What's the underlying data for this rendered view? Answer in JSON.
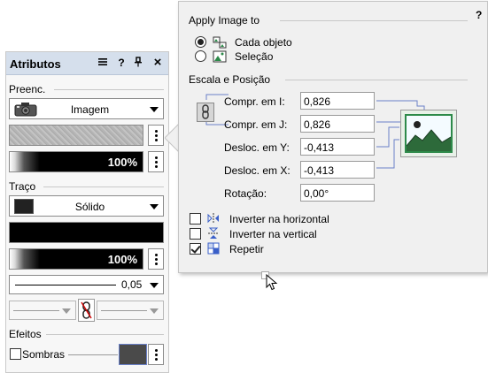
{
  "attributes_panel": {
    "title": "Atributos",
    "header_icons": [
      "menu-icon",
      "help-icon",
      "pin-icon",
      "close-icon"
    ],
    "help_label": "?",
    "close_label": "×",
    "fill": {
      "section_label": "Preenc.",
      "type_value": "Imagem",
      "opacity_value": "100%"
    },
    "stroke": {
      "section_label": "Traço",
      "style_value": "Sólido",
      "opacity_value": "100%",
      "width_value": "0,05"
    },
    "effects": {
      "section_label": "Efeitos",
      "shadows_label": "Sombras",
      "shadows_checked": false
    }
  },
  "popup": {
    "help_label": "?",
    "apply_section": "Apply Image to",
    "apply_options": [
      {
        "label": "Cada objeto",
        "selected": true
      },
      {
        "label": "Seleção",
        "selected": false
      }
    ],
    "scale_section": "Escala e Posição",
    "fields": [
      {
        "label": "Compr. em I:",
        "value": "0,826"
      },
      {
        "label": "Compr. em J:",
        "value": "0,826"
      },
      {
        "label": "Desloc. em Y:",
        "value": "-0,413"
      },
      {
        "label": "Desloc. em X:",
        "value": "-0,413"
      },
      {
        "label": "Rotação:",
        "value": "0,00°"
      }
    ],
    "checkboxes": [
      {
        "label": "Inverter na horizontal",
        "checked": false,
        "icon": "flip-horizontal-icon"
      },
      {
        "label": "Inverter na vertical",
        "checked": false,
        "icon": "flip-vertical-icon"
      },
      {
        "label": "Repetir",
        "checked": true,
        "icon": "repeat-icon"
      }
    ]
  },
  "colors": {
    "panel_header": "#d5dfec",
    "accent_blue": "#6a80c8",
    "preview_green": "#2d8a4a"
  }
}
